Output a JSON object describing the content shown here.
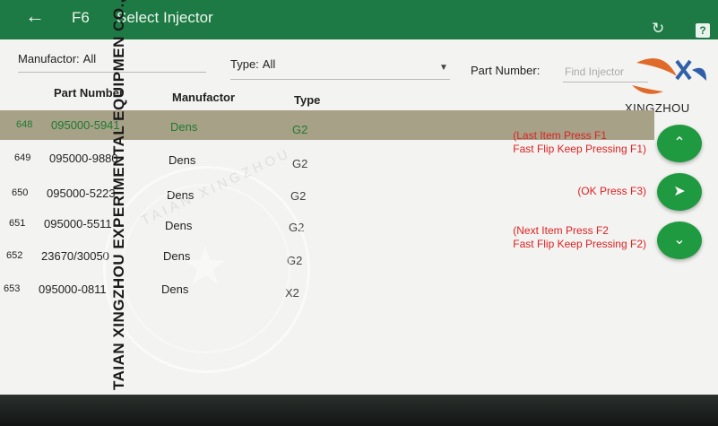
{
  "appbar": {
    "back_icon": "←",
    "code": "F6",
    "title": "Select Injector",
    "refresh_icon": "↻",
    "help_icon": "?"
  },
  "filters": {
    "manufactor_label": "Manufactor:",
    "manufactor_value": "All",
    "type_label": "Type:",
    "type_value": "All",
    "part_number_label": "Part Number:",
    "part_number_placeholder": "Find Injector"
  },
  "table": {
    "headers": {
      "part_number": "Part Number",
      "manufactor": "Manufactor",
      "type": "Type"
    },
    "rows": [
      {
        "idx": "648",
        "part": "095000-5941",
        "manu": "Dens",
        "type": "G2"
      },
      {
        "idx": "649",
        "part": "095000-9880",
        "manu": "Dens",
        "type": "G2"
      },
      {
        "idx": "650",
        "part": "095000-5223",
        "manu": "Dens",
        "type": "G2"
      },
      {
        "idx": "651",
        "part": "095000-5511",
        "manu": "Dens",
        "type": "G2"
      },
      {
        "idx": "652",
        "part": "23670/30050",
        "manu": "Dens",
        "type": "G2"
      },
      {
        "idx": "653",
        "part": "095000-0811",
        "manu": "Dens",
        "type": "X2"
      }
    ]
  },
  "hints": {
    "up_line1": "(Last Item Press F1",
    "up_line2": "Fast Flip Keep Pressing F1)",
    "ok": "(OK Press F3)",
    "down_line1": "(Next Item Press F2",
    "down_line2": "Fast Flip Keep Pressing F2)"
  },
  "buttons": {
    "up_icon": "⌃",
    "ok_icon": "➤",
    "down_icon": "⌄"
  },
  "logo": {
    "text": "XINGZHOU"
  },
  "watermark": {
    "vertical_text": "TAIAN XINGZHOU EXPERIMENTAL EQUIPMEN CO.,LTD",
    "arc_text": "TAIAN XINGZHOU"
  },
  "colors": {
    "appbar": "#1d7a44",
    "selected_row": "#a7a188",
    "fab": "#1f9a40",
    "hint": "#dd2222"
  }
}
